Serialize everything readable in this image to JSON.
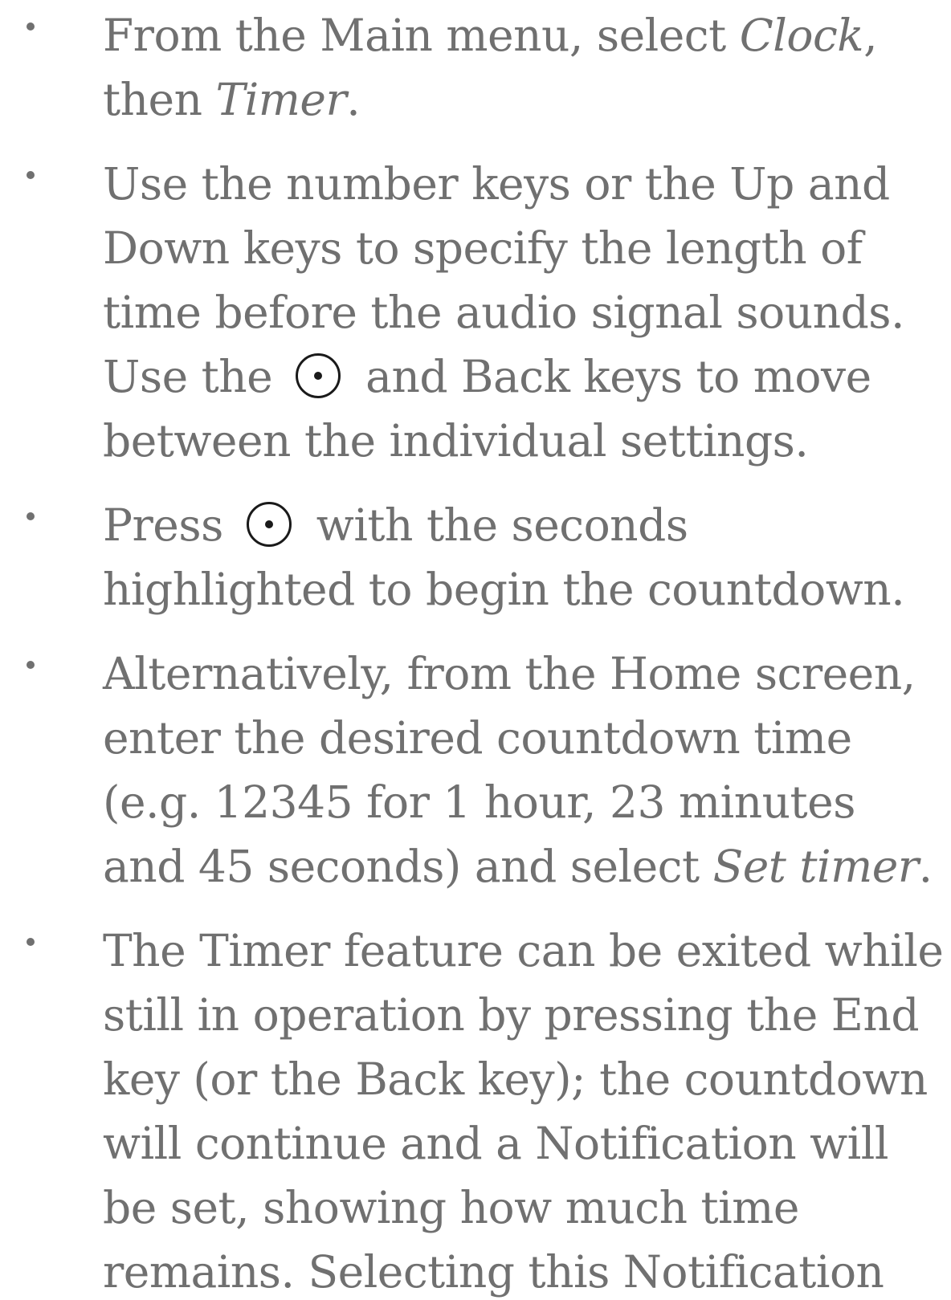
{
  "steps": [
    {
      "pre": "From the Main menu, select ",
      "em1": "Clock",
      "mid": ", then ",
      "em2": "Timer",
      "post": "."
    },
    {
      "text1": "Use the number keys or the Up and Down keys to specify the length of time before the audio signal sounds. Use the ",
      "icon": "select-key-icon",
      "text2": " and Back keys to move between the individual settings."
    },
    {
      "text1": "Press ",
      "icon": "select-key-icon",
      "text2": " with the seconds highlighted to begin the countdown."
    },
    {
      "pre": "Alternatively, from the Home screen, enter the desired countdown time (e.g. 12345 for 1 hour, 23 minutes and 45 seconds) and select ",
      "em": "Set timer",
      "post": "."
    },
    {
      "text": "The Timer feature can be exited while still in operation by pressing the End key (or the Back key); the countdown will continue and a Notification will be set, showing how much time remains. Selecting this Notification"
    }
  ]
}
